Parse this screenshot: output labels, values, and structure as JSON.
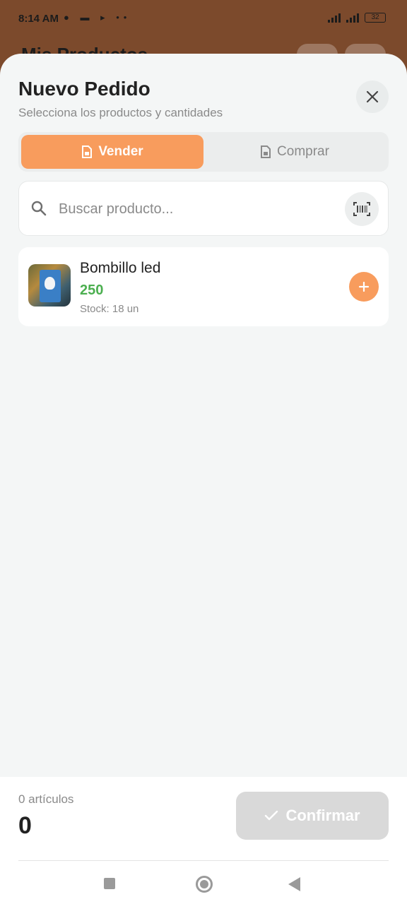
{
  "status_bar": {
    "time": "8:14 AM",
    "battery": "32"
  },
  "background": {
    "title": "Mis Productos"
  },
  "sheet": {
    "title": "Nuevo Pedido",
    "subtitle": "Selecciona los productos y cantidades",
    "tabs": [
      {
        "label": "Vender",
        "active": true
      },
      {
        "label": "Comprar",
        "active": false
      }
    ],
    "search": {
      "placeholder": "Buscar producto...",
      "value": ""
    },
    "products": [
      {
        "name": "Bombillo led",
        "price": "250",
        "stock": "Stock: 18 un"
      }
    ]
  },
  "footer": {
    "count": "0 artículos",
    "total": "0",
    "confirm_label": "Confirmar"
  },
  "colors": {
    "accent": "#f89c5d",
    "price": "#4caf50",
    "backdrop": "#7c4a2c"
  },
  "icons": [
    "close-icon",
    "sell-doc-icon",
    "buy-doc-icon",
    "search-icon",
    "barcode-icon",
    "plus-icon",
    "check-icon"
  ]
}
